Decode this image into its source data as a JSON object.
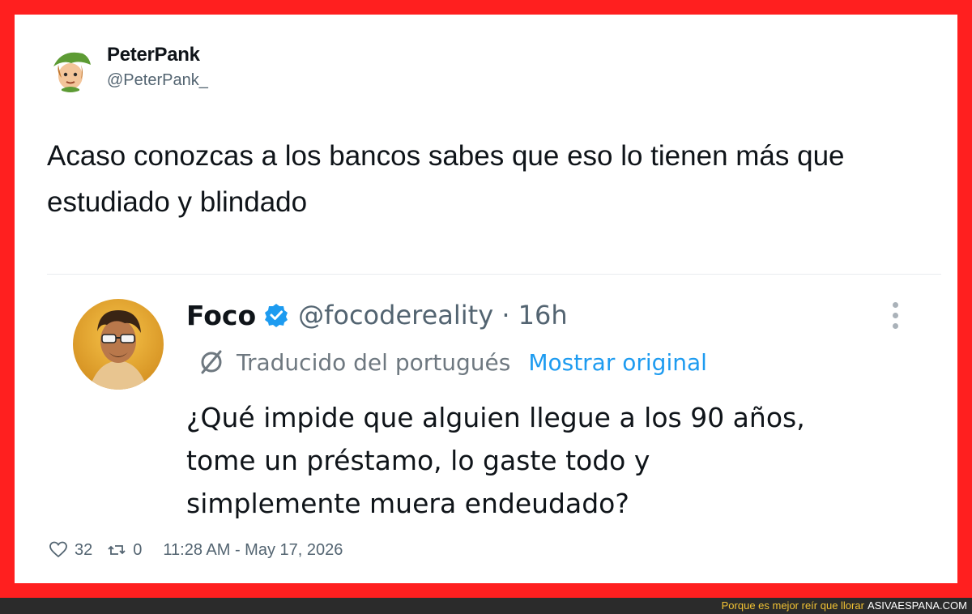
{
  "tweet": {
    "author_name": "PeterPank",
    "author_handle": "@PeterPank_",
    "text": "Acaso conozcas a los bancos sabes que eso lo tienen más que estudiado y blindado",
    "likes": "32",
    "retweets": "0",
    "timestamp": "11:28 AM - May 17, 2026"
  },
  "quoted": {
    "name": "Foco",
    "handle": "@focodereality · 16h",
    "translated_label": "Traducido del portugués",
    "show_original": "Mostrar original",
    "text": "¿Qué impide que alguien llegue a los 90 años, tome un préstamo, lo gaste todo y simplemente muera endeudado?"
  },
  "footer": {
    "slogan": "Porque es mejor reír que llorar",
    "site": "ASIVAESPANA.COM"
  },
  "colors": {
    "frame": "#ff1f1f",
    "link": "#1d9bf0",
    "secondary_text": "#536471",
    "footer_slogan": "#f2c233"
  },
  "icons": {
    "verified": "verified-badge-icon",
    "translate": "globe-icon",
    "more": "more-options-icon",
    "like": "heart-icon",
    "retweet": "retweet-icon"
  }
}
